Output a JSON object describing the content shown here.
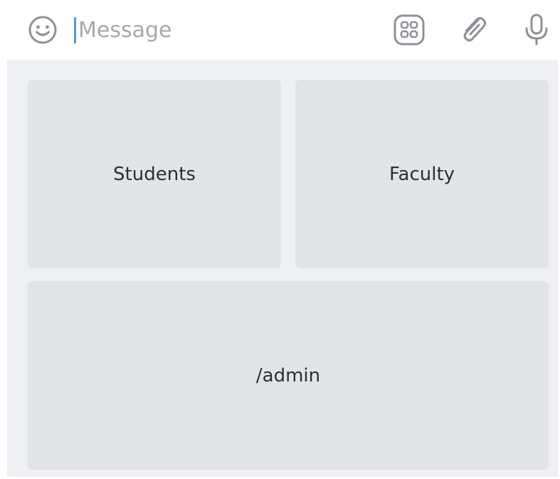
{
  "composer": {
    "placeholder": "Message",
    "value": ""
  },
  "icons": {
    "emoji": "smiley-icon",
    "keyboard": "bot-keyboard-icon",
    "attach": "paperclip-icon",
    "mic": "microphone-icon"
  },
  "colors": {
    "caret": "#4f9bd8",
    "icon": "#8e9196",
    "keyboard_bg": "#eff0f3",
    "key_bg": "#e2e4e7"
  },
  "keyboard": {
    "rows": [
      [
        {
          "label": "Students"
        },
        {
          "label": "Faculty"
        }
      ],
      [
        {
          "label": "/admin"
        }
      ]
    ]
  }
}
